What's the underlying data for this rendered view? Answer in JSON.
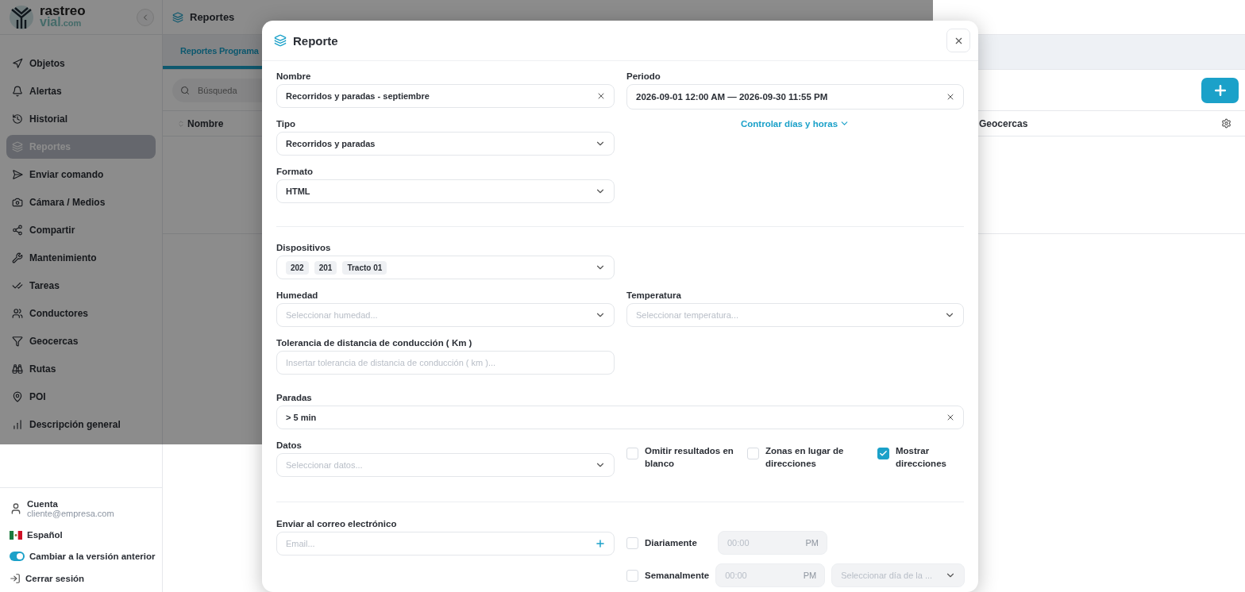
{
  "logo": {
    "line1": "rastreo",
    "line2": "vial",
    "suffix": ".com"
  },
  "sidebar": {
    "items": [
      {
        "label": "Objetos",
        "selected": false
      },
      {
        "label": "Alertas",
        "selected": false
      },
      {
        "label": "Historial",
        "selected": false
      },
      {
        "label": "Reportes",
        "selected": true
      },
      {
        "label": "Enviar comando",
        "selected": false
      },
      {
        "label": "Cámara / Medios",
        "selected": false
      },
      {
        "label": "Compartir",
        "selected": false
      },
      {
        "label": "Mantenimiento",
        "selected": false
      },
      {
        "label": "Tareas",
        "selected": false
      },
      {
        "label": "Conductores",
        "selected": false
      },
      {
        "label": "Geocercas",
        "selected": false
      },
      {
        "label": "Rutas",
        "selected": false
      },
      {
        "label": "POI",
        "selected": false
      },
      {
        "label": "Descripción general",
        "selected": false
      }
    ]
  },
  "account": {
    "label": "Cuenta",
    "email": "cliente@empresa.com"
  },
  "language": "Español",
  "legacy_toggle": {
    "label": "Cambiar a la versión anterior",
    "on": true
  },
  "logout": "Cerrar sesión",
  "page": {
    "title": "Reportes",
    "tabs": [
      {
        "label": "Reportes Programa",
        "selected": true
      }
    ],
    "search": {
      "placeholder": "Búsqueda"
    },
    "columns": [
      "Nombre",
      "Geocercas"
    ]
  },
  "modal": {
    "title": "Reporte",
    "nombre": {
      "label": "Nombre",
      "value": "Recorridos y paradas - septiembre"
    },
    "periodo": {
      "label": "Periodo",
      "value": "2026-09-01 12:00 AM — 2026-09-30 11:55 PM",
      "link": "Controlar días y horas"
    },
    "tipo": {
      "label": "Tipo",
      "value": "Recorridos y paradas"
    },
    "formato": {
      "label": "Formato",
      "value": "HTML"
    },
    "dispositivos": {
      "label": "Dispositivos",
      "tags": [
        "202",
        "201",
        "Tracto 01"
      ]
    },
    "humedad": {
      "label": "Humedad",
      "placeholder": "Seleccionar humedad..."
    },
    "temperatura": {
      "label": "Temperatura",
      "placeholder": "Seleccionar temperatura..."
    },
    "tolerancia": {
      "label": "Tolerancia de distancia de conducción ( Km )",
      "placeholder": "Insertar tolerancia de distancia de conducción ( km )..."
    },
    "paradas": {
      "label": "Paradas",
      "value": "> 5 min"
    },
    "datos": {
      "label": "Datos",
      "placeholder": "Seleccionar datos..."
    },
    "options": [
      {
        "label": "Omitir resultados en blanco",
        "checked": false
      },
      {
        "label": "Zonas en lugar de direcciones",
        "checked": false
      },
      {
        "label": "Mostrar direcciones",
        "checked": true
      }
    ],
    "email": {
      "label": "Enviar al correo electrónico",
      "placeholder": "Email..."
    },
    "schedules": [
      {
        "label": "Diariamente",
        "checked": false,
        "placeholder": "00:00",
        "ampm": "PM"
      },
      {
        "label": "Semanalmente",
        "checked": false,
        "placeholder": "00:00",
        "ampm": "PM",
        "day_placeholder": "Seleccionar día de la ..."
      }
    ]
  }
}
